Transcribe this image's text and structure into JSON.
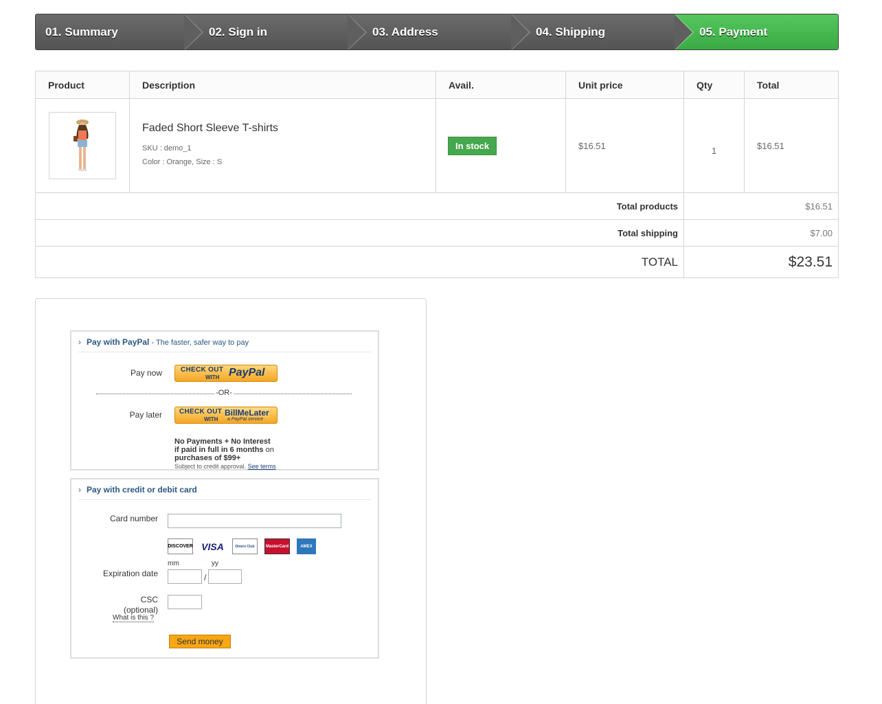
{
  "steps": [
    {
      "label": "01. Summary"
    },
    {
      "label": "02. Sign in"
    },
    {
      "label": "03. Address"
    },
    {
      "label": "04. Shipping"
    },
    {
      "label": "05. Payment"
    }
  ],
  "cart": {
    "headers": [
      "Product",
      "Description",
      "Avail.",
      "Unit price",
      "Qty",
      "Total"
    ],
    "item": {
      "name": "Faded Short Sleeve T-shirts",
      "sku": "SKU : demo_1",
      "attrs": "Color : Orange, Size : S",
      "availability": "In stock",
      "unit_price": "$16.51",
      "qty": "1",
      "total": "$16.51"
    },
    "total_products_label": "Total products",
    "total_products": "$16.51",
    "total_shipping_label": "Total shipping",
    "total_shipping": "$7.00",
    "total_label": "TOTAL",
    "total": "$23.51"
  },
  "paypal": {
    "heading": "Pay with PayPal",
    "heading_sub": " - The faster, safer way to pay",
    "pay_now": "Pay now",
    "pay_later": "Pay later",
    "checkout": "CHECK OUT",
    "with": "WITH",
    "paypal_logo": "PayPal",
    "bml_logo": "BillMeLater",
    "bml_sub": "a PayPal service",
    "or": "-OR-",
    "nopay_line1": "No Payments + No Interest",
    "nopay_line2": "if paid in full in 6 months",
    "nopay_on": " on",
    "nopay_line3": "purchases of $99+",
    "fine": "Subject to credit approval. ",
    "see_terms": "See terms"
  },
  "card": {
    "heading": "Pay with credit or debit card",
    "card_number": "Card number",
    "logos": [
      "DISCOVER",
      "VISA",
      "Diners Club",
      "MasterCard",
      "AMEX"
    ],
    "mm": "mm",
    "yy": "yy",
    "slash": "/",
    "expiration": "Expiration date",
    "csc": "CSC",
    "optional": "(optional)",
    "what_is": "What is this ?",
    "send": "Send money"
  },
  "colors": {
    "step_active": "#46b34f",
    "step_default": "#5f5f5f",
    "stock_badge": "#46a74e",
    "send_button": "#f7a615"
  }
}
